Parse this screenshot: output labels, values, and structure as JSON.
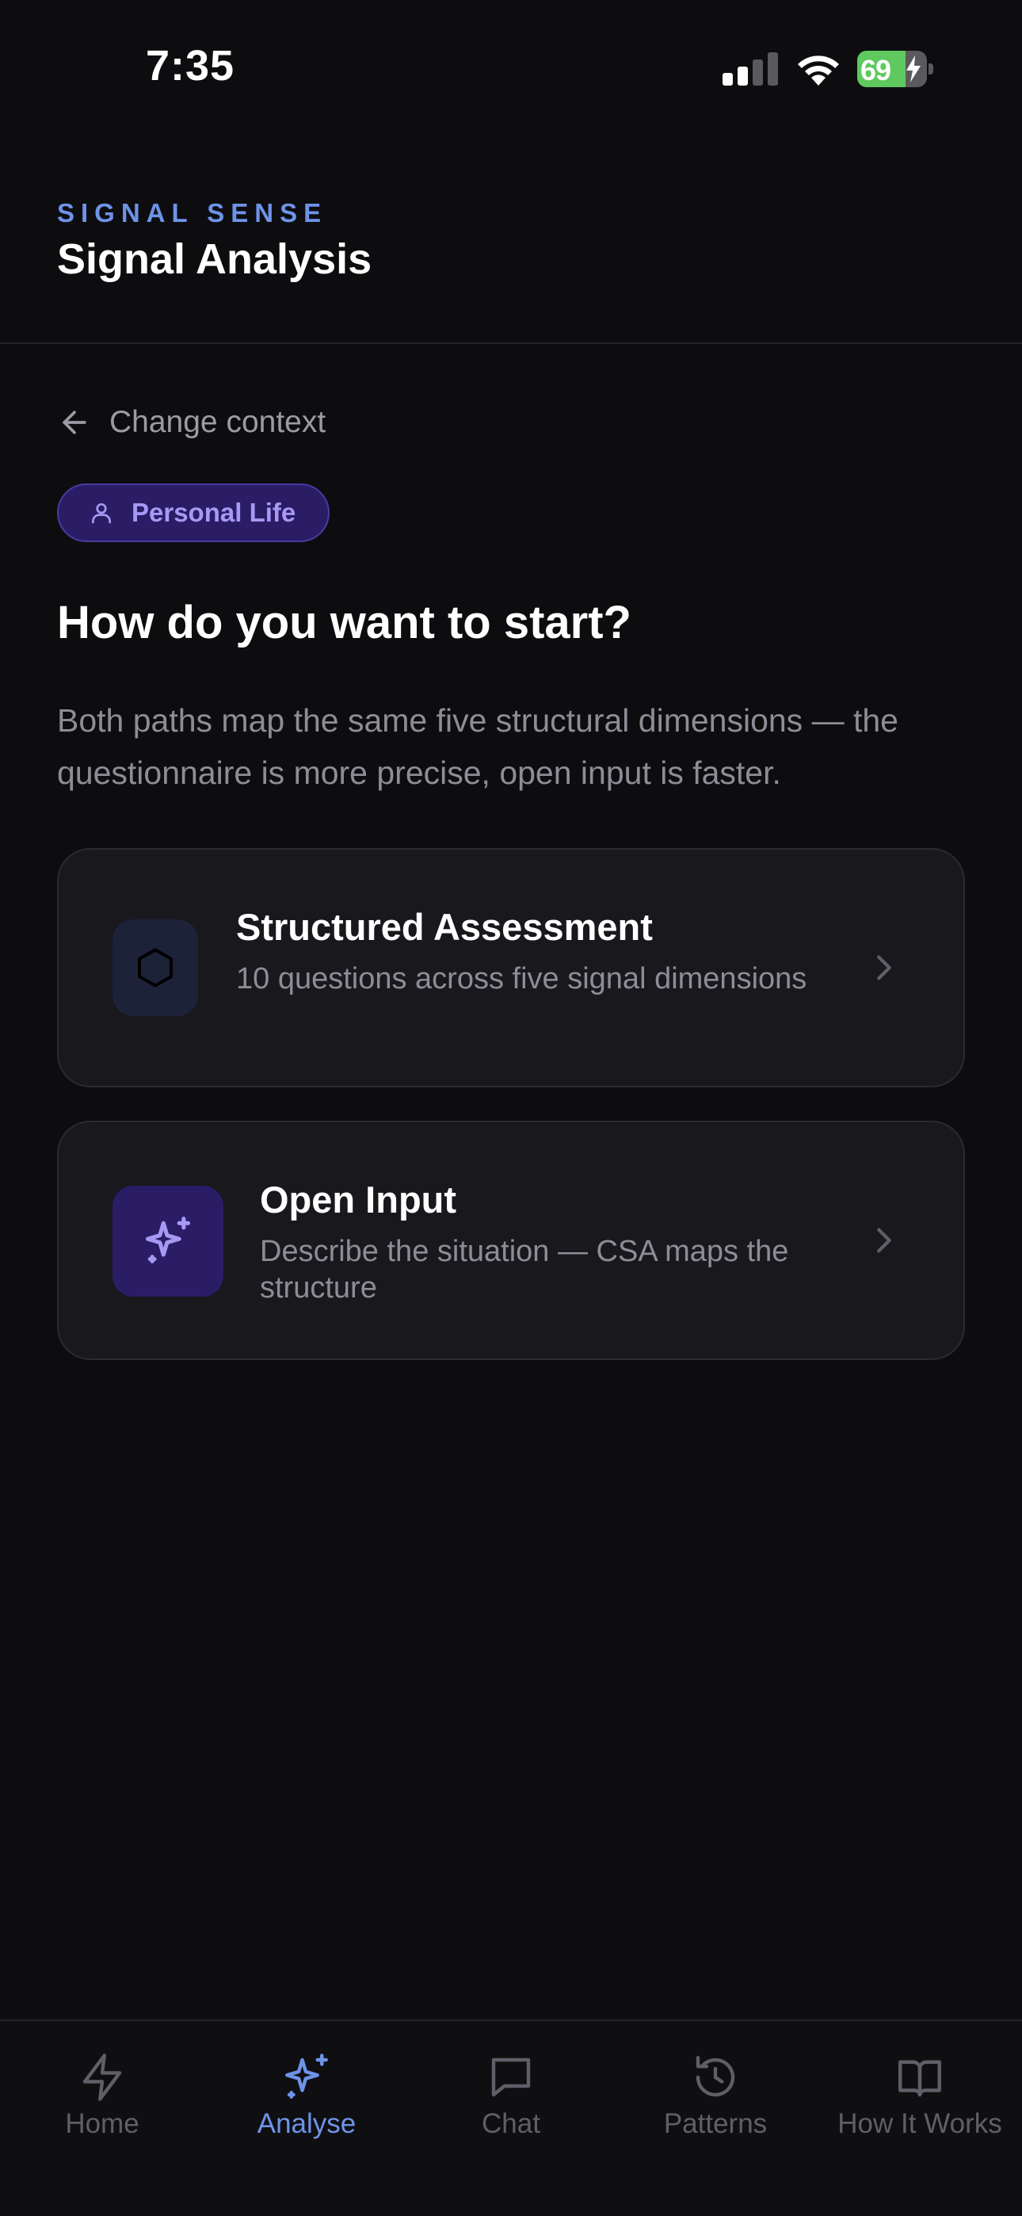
{
  "status_bar": {
    "time": "7:35",
    "battery_percent": "69",
    "battery_level": 0.69,
    "signal_bars_filled": 2,
    "charging": true
  },
  "header": {
    "eyebrow": "SIGNAL SENSE",
    "title": "Signal Analysis"
  },
  "back_link": {
    "label": "Change context",
    "icon": "arrow-left-icon"
  },
  "context_chip": {
    "label": "Personal Life",
    "icon": "person-icon"
  },
  "prompt": {
    "question": "How do you want to start?",
    "description": "Both paths map the same five structural dimensions — the questionnaire is more precise, open input is faster."
  },
  "options": [
    {
      "title": "Structured Assessment",
      "subtitle": "10 questions across five signal dimensions",
      "icon": "hexagon-icon"
    },
    {
      "title": "Open Input",
      "subtitle": "Describe the situation — CSA maps the structure",
      "icon": "sparkles-icon"
    }
  ],
  "tab_bar": {
    "active": "Analyse",
    "tabs": [
      {
        "label": "Home",
        "icon": "lightning-icon"
      },
      {
        "label": "Analyse",
        "icon": "sparkles-icon"
      },
      {
        "label": "Chat",
        "icon": "chat-bubble-icon"
      },
      {
        "label": "Patterns",
        "icon": "history-icon"
      },
      {
        "label": "How It Works",
        "icon": "book-icon"
      }
    ]
  },
  "colors": {
    "background": "#0d0d10",
    "accent_blue": "#6e93e8",
    "accent_purple": "#a898f4",
    "card_background": "#18181d",
    "battery_green": "#5fc95f"
  }
}
